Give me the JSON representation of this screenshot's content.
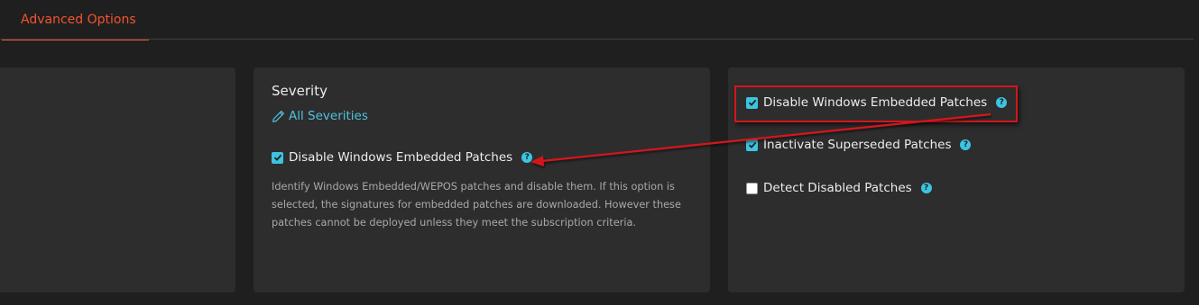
{
  "tabs": [
    {
      "label": "Advanced Options",
      "active": true
    }
  ],
  "severity_panel": {
    "title": "Severity",
    "link_label": "All Severities",
    "option": {
      "label": "Disable Windows Embedded Patches",
      "checked": true
    },
    "description": "Identify Windows Embedded/WEPOS patches and disable them. If this option is selected, the signatures for embedded patches are downloaded. However these patches cannot be deployed unless they meet the subscription criteria."
  },
  "options_panel": {
    "options": [
      {
        "label": "Disable Windows Embedded Patches",
        "checked": true
      },
      {
        "label": "Inactivate Superseded Patches",
        "checked": true
      },
      {
        "label": "Detect Disabled Patches",
        "checked": false
      }
    ]
  },
  "help_glyph": "?",
  "colors": {
    "accent": "#f1542f",
    "link": "#4fc3e0",
    "checkbox": "#3cc4e0",
    "annotation": "#d4151b"
  }
}
